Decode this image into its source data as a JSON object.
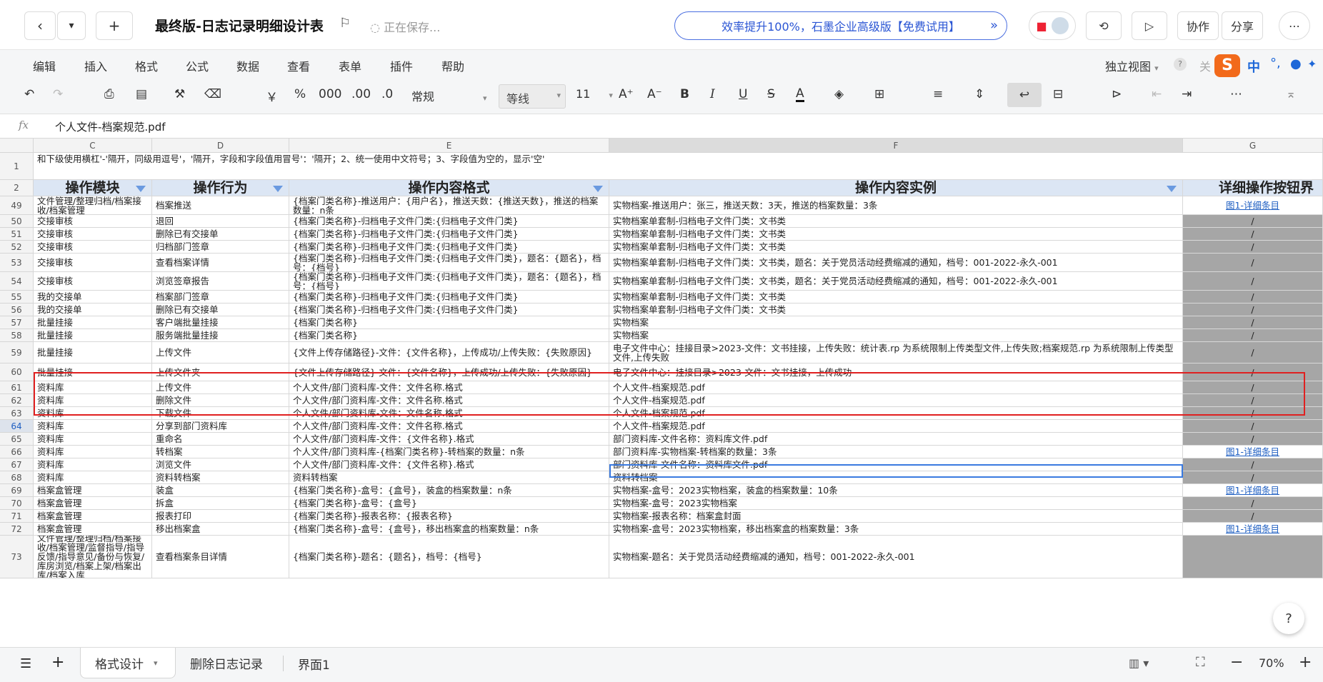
{
  "header": {
    "title": "最终版-日志记录明细设计表",
    "saving": "正在保存...",
    "promo": "效率提升100%，石墨企业高级版【免费试用】",
    "collab": "协作",
    "share": "分享"
  },
  "menu": {
    "items": [
      "编辑",
      "插入",
      "格式",
      "公式",
      "数据",
      "查看",
      "表单",
      "插件",
      "帮助"
    ],
    "view_mode": "独立视图",
    "close_partial": "关",
    "ime_label": "中"
  },
  "toolbar": {
    "currency": "￥",
    "percent": "%",
    "thousands": "000",
    "dec_inc": ".00",
    "dec_dec": ".0",
    "number_format": "常规",
    "font_family": "等线",
    "font_size": "11"
  },
  "formula_bar": {
    "fx": "fx",
    "value": "个人文件-档案规范.pdf"
  },
  "columns": [
    "C",
    "D",
    "E",
    "F",
    "G"
  ],
  "row1_text": "和下级使用横杠'-'隔开，同级用逗号'，'隔开，字段和字段值用冒号'：'隔开；2、统一使用中文符号；3、字段值为空的，显示'空'",
  "headers": [
    "操作模块",
    "操作行为",
    "操作内容格式",
    "操作内容实例",
    "详细操作按钮界"
  ],
  "rows": [
    {
      "n": "49",
      "c": "文件管理/整理归档/档案接收/档案管理",
      "d": "档案推送",
      "e": "{档案门类名称}-推送用户：{用户名}，推送天数：{推送天数}，推送的档案数量：n条",
      "f": "实物档案-推送用户：张三，推送天数：3天，推送的档案数量：3条",
      "g": "图1-详细条目"
    },
    {
      "n": "50",
      "c": "交接审核",
      "d": "退回",
      "e": "{档案门类名称}-归档电子文件门类:{归档电子文件门类}",
      "f": "实物档案单套制-归档电子文件门类：文书类",
      "g": "/"
    },
    {
      "n": "51",
      "c": "交接审核",
      "d": "删除已有交接单",
      "e": "{档案门类名称}-归档电子文件门类:{归档电子文件门类}",
      "f": "实物档案单套制-归档电子文件门类：文书类",
      "g": "/"
    },
    {
      "n": "52",
      "c": "交接审核",
      "d": "归档部门签章",
      "e": "{档案门类名称}-归档电子文件门类:{归档电子文件门类}",
      "f": "实物档案单套制-归档电子文件门类：文书类",
      "g": "/"
    },
    {
      "n": "53",
      "c": "交接审核",
      "d": "查看档案详情",
      "e": "{档案门类名称}-归档电子文件门类:{归档电子文件门类}，题名：{题名}，档号：{档号}",
      "f": "实物档案单套制-归档电子文件门类：文书类，题名：关于党员活动经费缩减的通知，档号：001-2022-永久-001",
      "g": "/"
    },
    {
      "n": "54",
      "c": "交接审核",
      "d": "浏览签章报告",
      "e": "{档案门类名称}-归档电子文件门类:{归档电子文件门类}，题名：{题名}，档号：{档号}",
      "f": "实物档案单套制-归档电子文件门类：文书类，题名：关于党员活动经费缩减的通知，档号：001-2022-永久-001",
      "g": "/"
    },
    {
      "n": "55",
      "c": "我的交接单",
      "d": "档案部门签章",
      "e": "{档案门类名称}-归档电子文件门类:{归档电子文件门类}",
      "f": "实物档案单套制-归档电子文件门类：文书类",
      "g": "/"
    },
    {
      "n": "56",
      "c": "我的交接单",
      "d": "删除已有交接单",
      "e": "{档案门类名称}-归档电子文件门类:{归档电子文件门类}",
      "f": "实物档案单套制-归档电子文件门类：文书类",
      "g": "/"
    },
    {
      "n": "57",
      "c": "批量挂接",
      "d": "客户端批量挂接",
      "e": "{档案门类名称}",
      "f": "实物档案",
      "g": "/"
    },
    {
      "n": "58",
      "c": "批量挂接",
      "d": "服务端批量挂接",
      "e": "{档案门类名称}",
      "f": "实物档案",
      "g": "/"
    },
    {
      "n": "59",
      "c": "批量挂接",
      "d": "上传文件",
      "e": "{文件上传存储路径}-文件：{文件名称}，上传成功/上传失败：{失败原因}",
      "f": "电子文件中心：挂接目录>2023-文件：文书挂接，上传失败：统计表.rp 为系统限制上传类型文件,上传失败;档案规范.rp 为系统限制上传类型文件,上传失败",
      "g": "/"
    },
    {
      "n": "60",
      "c": "批量挂接",
      "d": "上传文件夹",
      "e": "{文件上传存储路径}-文件：{文件名称}，上传成功/上传失败：{失败原因}",
      "f": "电子文件中心：挂接目录>2023-文件：文书挂接，上传成功",
      "g": "/"
    },
    {
      "n": "61",
      "c": "资料库",
      "d": "上传文件",
      "e": "个人文件/部门资料库-文件：文件名称.格式",
      "f": "个人文件-档案规范.pdf",
      "g": "/"
    },
    {
      "n": "62",
      "c": "资料库",
      "d": "删除文件",
      "e": "个人文件/部门资料库-文件：文件名称.格式",
      "f": "个人文件-档案规范.pdf",
      "g": "/"
    },
    {
      "n": "63",
      "c": "资料库",
      "d": "下载文件",
      "e": "个人文件/部门资料库-文件：文件名称.格式",
      "f": "个人文件-档案规范.pdf",
      "g": "/"
    },
    {
      "n": "64",
      "c": "资料库",
      "d": "分享到部门资料库",
      "e": "个人文件/部门资料库-文件：文件名称.格式",
      "f": "个人文件-档案规范.pdf",
      "g": "/"
    },
    {
      "n": "65",
      "c": "资料库",
      "d": "重命名",
      "e": "个人文件/部门资料库-文件：{文件名称}.格式",
      "f": "部门资料库-文件名称：资料库文件.pdf",
      "g": "/"
    },
    {
      "n": "66",
      "c": "资料库",
      "d": "转档案",
      "e": "个人文件/部门资料库-{档案门类名称}-转档案的数量：n条",
      "f": "部门资料库-实物档案-转档案的数量：3条",
      "g": "图1-详细条目"
    },
    {
      "n": "67",
      "c": "资料库",
      "d": "浏览文件",
      "e": "个人文件/部门资料库-文件：{文件名称}.格式",
      "f": "部门资料库-文件名称：资料库文件.pdf",
      "g": "/"
    },
    {
      "n": "68",
      "c": "资料库",
      "d": "资料转档案",
      "e": "资料转档案",
      "f": "资料转档案",
      "g": "/"
    },
    {
      "n": "69",
      "c": "档案盒管理",
      "d": "装盒",
      "e": "{档案门类名称}-盒号：{盒号}，装盒的档案数量：n条",
      "f": "实物档案-盒号：2023实物档案，装盒的档案数量：10条",
      "g": "图1-详细条目"
    },
    {
      "n": "70",
      "c": "档案盒管理",
      "d": "拆盒",
      "e": "{档案门类名称}-盒号：{盒号}",
      "f": "实物档案-盒号：2023实物档案",
      "g": "/"
    },
    {
      "n": "71",
      "c": "档案盒管理",
      "d": "报表打印",
      "e": "{档案门类名称}-报表名称：{报表名称}",
      "f": "实物档案-报表名称：档案盒封面",
      "g": "/"
    },
    {
      "n": "72",
      "c": "档案盒管理",
      "d": "移出档案盒",
      "e": "{档案门类名称}-盒号：{盒号}，移出档案盒的档案数量：n条",
      "f": "实物档案-盒号：2023实物档案，移出档案盒的档案数量：3条",
      "g": "图1-详细条目"
    },
    {
      "n": "73",
      "c": "文件管理/整理归档/档案接收/档案管理/监督指导/指导反馈/指导意见/备份与恢复/库房浏览/档案上架/档案出库/档案入库",
      "d": "查看档案条目详情",
      "e": "{档案门类名称}-题名：{题名}，档号：{档号}",
      "f": "实物档案-题名：关于党员活动经费缩减的通知，档号：001-2022-永久-001",
      "g": ""
    }
  ],
  "sheets": [
    "格式设计",
    "删除日志记录",
    "界面1"
  ],
  "zoom": "70%"
}
